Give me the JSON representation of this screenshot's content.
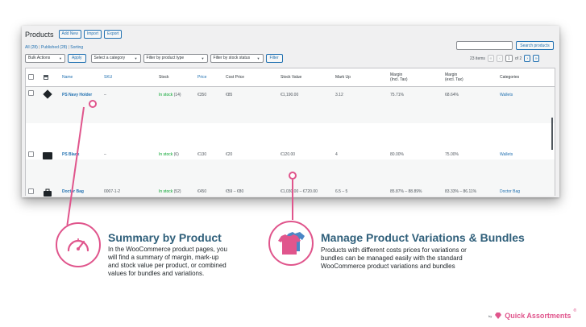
{
  "header": {
    "title": "Products",
    "buttons": [
      "Add New",
      "Import",
      "Export"
    ]
  },
  "views": {
    "all": "All (28)",
    "published": "Published (28)",
    "sorting": "Sorting",
    "sep": "|"
  },
  "search": {
    "button": "Search products",
    "value": ""
  },
  "filters": {
    "bulk_actions": "Bulk Actions",
    "apply": "Apply",
    "category": "Select a category",
    "product_type": "Filter by product type",
    "stock_status": "Filter by stock status",
    "filter": "Filter"
  },
  "pagination": {
    "items": "23 items",
    "first": "«",
    "prev": "‹",
    "current": "1",
    "of": "of 2",
    "next": "›",
    "last": "»"
  },
  "table": {
    "headers": {
      "name": "Name",
      "sku": "SKU",
      "stock": "Stock",
      "price": "Price",
      "cost": "Cost Price",
      "stock_value": "Stock Value",
      "markup": "Mark Up",
      "margin_incl_1": "Margin",
      "margin_incl_2": "(Incl. Tax)",
      "margin_excl_1": "Margin",
      "margin_excl_2": "(excl. Tax)",
      "categories": "Categories"
    },
    "rows": [
      {
        "name": "PS Navy Holder",
        "sku": "–",
        "stock_label": "In stock",
        "stock_count": "(14)",
        "price": "€350",
        "cost": "€85",
        "stock_value": "€1,190.00",
        "markup": "3.12",
        "margin_incl": "75.71%",
        "margin_excl": "68.64%",
        "category": "Wallets"
      },
      {
        "name": "PS Black",
        "sku": "–",
        "stock_label": "In stock",
        "stock_count": "(6)",
        "price": "€130",
        "cost": "€20",
        "stock_value": "€120.00",
        "markup": "4",
        "margin_incl": "80.00%",
        "margin_excl": "75.00%",
        "category": "Wallets"
      },
      {
        "name": "Doctor Bag",
        "sku": "0007-1-2",
        "stock_label": "In stock",
        "stock_count": "(52)",
        "price": "€450",
        "cost": "€59 – €80",
        "stock_value": "€1,030.00 – €720.00",
        "markup": "6.5 – 5",
        "margin_incl": "85.87% – 88.89%",
        "margin_excl": "83.33% – 86.11%",
        "category": "Doctor Bag"
      }
    ]
  },
  "features": {
    "left": {
      "title": "Summary by Product",
      "body": [
        "In the WooCommerce product pages, you",
        "will find a summary of margin, mark-up",
        "and stock value per product, or combined",
        "values for bundles and variations."
      ],
      "icon": "speedometer-icon"
    },
    "right": {
      "title": "Manage Product Variations & Bundles",
      "body": [
        "Products with different costs prices for variations or",
        "bundles can be managed easily with the standard",
        "WooCommerce product variations and bundles"
      ],
      "icon": "tshirts-icon"
    }
  },
  "brand": {
    "by": "by",
    "name": "Quick Assortments",
    "mark": "®"
  },
  "colors": {
    "accent": "#e0558c",
    "title": "#2f5f7a",
    "link": "#2271b1",
    "instock": "#00a32a"
  }
}
